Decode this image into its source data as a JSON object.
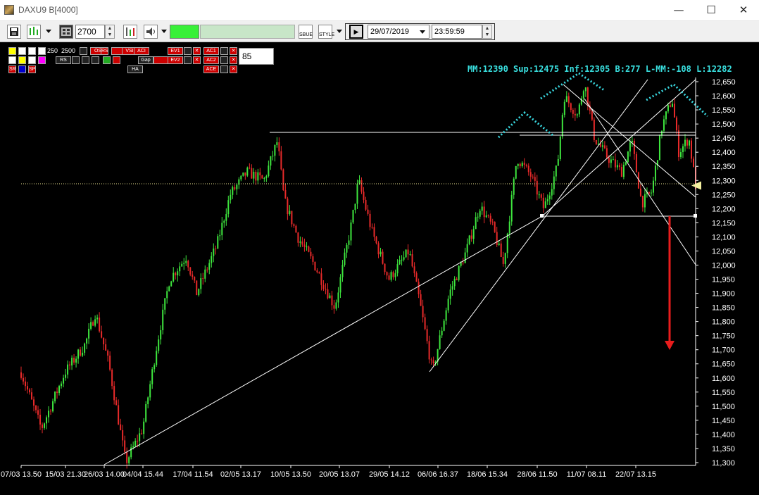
{
  "window": {
    "title": "DAXU9 B[4000]",
    "minimize": "—",
    "maximize": "☐",
    "close": "✕"
  },
  "toolbar": {
    "bars_value": "2700",
    "date_value": "29/07/2019",
    "time_value": "23:59:59",
    "sbue_label": "SBUE",
    "style_label": "STYLE"
  },
  "chart_tools": {
    "row1_nums": [
      "250",
      "2500"
    ],
    "ind_labels": [
      "OS",
      "RS",
      "VSI",
      "ACI",
      "EV1",
      "AC1",
      "EV2",
      "AC2",
      "ACE"
    ],
    "misc_labels": [
      "Gap",
      "HA",
      "SR",
      "SP",
      "RS"
    ],
    "smoothing": "85"
  },
  "chart_data": {
    "type": "candlestick",
    "title": "MM:12390 Sup:12475 Inf:12305 B:277 L-MM:-108 L:12282",
    "y_ticks": [
      12650,
      12600,
      12550,
      12500,
      12450,
      12400,
      12350,
      12300,
      12250,
      12200,
      12150,
      12100,
      12050,
      12000,
      11950,
      11900,
      11850,
      11800,
      11750,
      11700,
      11650,
      11600,
      11550,
      11500,
      11450,
      11400,
      11350,
      11300
    ],
    "ylim": [
      11300,
      12650
    ],
    "x_ticks": [
      "07/03 13.50",
      "15/03 21.30",
      "26/03 14.00",
      "04/04 15.44",
      "17/04 11.54",
      "02/05 13.17",
      "10/05 13.50",
      "20/05 13.07",
      "29/05 14.12",
      "06/06 16.37",
      "18/06 15.34",
      "28/06 11.50",
      "11/07 08.11",
      "22/07 13.15"
    ],
    "last_price": 12282,
    "key_path": [
      {
        "t": 0,
        "v": 11620
      },
      {
        "t": 0.03,
        "v": 11420
      },
      {
        "t": 0.065,
        "v": 11620
      },
      {
        "t": 0.095,
        "v": 11720
      },
      {
        "t": 0.11,
        "v": 11830
      },
      {
        "t": 0.13,
        "v": 11650
      },
      {
        "t": 0.155,
        "v": 11300
      },
      {
        "t": 0.18,
        "v": 11420
      },
      {
        "t": 0.2,
        "v": 11700
      },
      {
        "t": 0.22,
        "v": 11950
      },
      {
        "t": 0.245,
        "v": 12030
      },
      {
        "t": 0.26,
        "v": 11900
      },
      {
        "t": 0.29,
        "v": 12070
      },
      {
        "t": 0.31,
        "v": 12250
      },
      {
        "t": 0.335,
        "v": 12330
      },
      {
        "t": 0.36,
        "v": 12300
      },
      {
        "t": 0.38,
        "v": 12440
      },
      {
        "t": 0.39,
        "v": 12230
      },
      {
        "t": 0.41,
        "v": 12100
      },
      {
        "t": 0.435,
        "v": 12000
      },
      {
        "t": 0.465,
        "v": 11850
      },
      {
        "t": 0.49,
        "v": 12150
      },
      {
        "t": 0.5,
        "v": 12300
      },
      {
        "t": 0.52,
        "v": 12120
      },
      {
        "t": 0.545,
        "v": 11950
      },
      {
        "t": 0.575,
        "v": 12050
      },
      {
        "t": 0.59,
        "v": 11880
      },
      {
        "t": 0.61,
        "v": 11620
      },
      {
        "t": 0.635,
        "v": 11900
      },
      {
        "t": 0.66,
        "v": 12050
      },
      {
        "t": 0.68,
        "v": 12210
      },
      {
        "t": 0.7,
        "v": 12130
      },
      {
        "t": 0.715,
        "v": 12000
      },
      {
        "t": 0.735,
        "v": 12380
      },
      {
        "t": 0.755,
        "v": 12320
      },
      {
        "t": 0.775,
        "v": 12200
      },
      {
        "t": 0.795,
        "v": 12350
      },
      {
        "t": 0.805,
        "v": 12600
      },
      {
        "t": 0.825,
        "v": 12530
      },
      {
        "t": 0.835,
        "v": 12650
      },
      {
        "t": 0.85,
        "v": 12450
      },
      {
        "t": 0.87,
        "v": 12380
      },
      {
        "t": 0.89,
        "v": 12330
      },
      {
        "t": 0.905,
        "v": 12440
      },
      {
        "t": 0.92,
        "v": 12220
      },
      {
        "t": 0.935,
        "v": 12260
      },
      {
        "t": 0.95,
        "v": 12490
      },
      {
        "t": 0.965,
        "v": 12590
      },
      {
        "t": 0.975,
        "v": 12400
      },
      {
        "t": 0.99,
        "v": 12450
      },
      {
        "t": 1.0,
        "v": 12282
      }
    ],
    "grid": false,
    "colors": {
      "up": "#3ee63e",
      "down": "#e82a2a",
      "background": "#000000",
      "annotation": "#39d8e0",
      "arrow": "#e81c1c",
      "axis": "#ffffff"
    }
  }
}
